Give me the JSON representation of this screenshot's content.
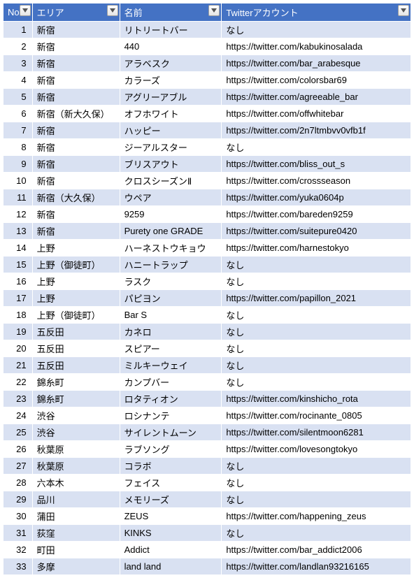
{
  "headers": {
    "no": "No.",
    "area": "エリア",
    "name": "名前",
    "twitter": "Twitterアカウント"
  },
  "rows": [
    {
      "no": "1",
      "area": "新宿",
      "name": "リトリートバー",
      "twitter": "なし"
    },
    {
      "no": "2",
      "area": "新宿",
      "name": "440",
      "twitter": "https://twitter.com/kabukinosalada"
    },
    {
      "no": "3",
      "area": "新宿",
      "name": "アラベスク",
      "twitter": "https://twitter.com/bar_arabesque"
    },
    {
      "no": "4",
      "area": "新宿",
      "name": "カラーズ",
      "twitter": "https://twitter.com/colorsbar69"
    },
    {
      "no": "5",
      "area": "新宿",
      "name": "アグリーアブル",
      "twitter": "https://twitter.com/agreeable_bar"
    },
    {
      "no": "6",
      "area": "新宿（新大久保）",
      "name": "オフホワイト",
      "twitter": "https://twitter.com/offwhitebar"
    },
    {
      "no": "7",
      "area": "新宿",
      "name": "ハッピー",
      "twitter": "https://twitter.com/2n7ltmbvv0vfb1f"
    },
    {
      "no": "8",
      "area": "新宿",
      "name": "ジーアルスター",
      "twitter": "なし"
    },
    {
      "no": "9",
      "area": "新宿",
      "name": "ブリスアウト",
      "twitter": "https://twitter.com/bliss_out_s"
    },
    {
      "no": "10",
      "area": "新宿",
      "name": "クロスシーズンⅡ",
      "twitter": "https://twitter.com/crossseason"
    },
    {
      "no": "11",
      "area": "新宿（大久保）",
      "name": "ウペア",
      "twitter": "https://twitter.com/yuka0604p"
    },
    {
      "no": "12",
      "area": "新宿",
      "name": "9259",
      "twitter": "https://twitter.com/bareden9259"
    },
    {
      "no": "13",
      "area": "新宿",
      "name": "Purety one GRADE",
      "twitter": "https://twitter.com/suitepure0420"
    },
    {
      "no": "14",
      "area": "上野",
      "name": "ハーネストウキョウ",
      "twitter": "https://twitter.com/harnestokyo"
    },
    {
      "no": "15",
      "area": "上野（御徒町）",
      "name": "ハニートラップ",
      "twitter": "なし"
    },
    {
      "no": "16",
      "area": "上野",
      "name": "ラスク",
      "twitter": "なし"
    },
    {
      "no": "17",
      "area": "上野",
      "name": "パピヨン",
      "twitter": "https://twitter.com/papillon_2021"
    },
    {
      "no": "18",
      "area": "上野（御徒町）",
      "name": "Bar S",
      "twitter": "なし"
    },
    {
      "no": "19",
      "area": "五反田",
      "name": "カネロ",
      "twitter": "なし"
    },
    {
      "no": "20",
      "area": "五反田",
      "name": "スピアー",
      "twitter": "なし"
    },
    {
      "no": "21",
      "area": "五反田",
      "name": "ミルキーウェイ",
      "twitter": "なし"
    },
    {
      "no": "22",
      "area": "錦糸町",
      "name": "カンプバー",
      "twitter": "なし"
    },
    {
      "no": "23",
      "area": "錦糸町",
      "name": "ロタティオン",
      "twitter": "https://twitter.com/kinshicho_rota"
    },
    {
      "no": "24",
      "area": "渋谷",
      "name": "ロシナンテ",
      "twitter": "https://twitter.com/rocinante_0805"
    },
    {
      "no": "25",
      "area": "渋谷",
      "name": "サイレントムーン",
      "twitter": "https://twitter.com/silentmoon6281"
    },
    {
      "no": "26",
      "area": "秋葉原",
      "name": "ラブソング",
      "twitter": "https://twitter.com/lovesongtokyo"
    },
    {
      "no": "27",
      "area": "秋葉原",
      "name": "コラボ",
      "twitter": "なし"
    },
    {
      "no": "28",
      "area": "六本木",
      "name": "フェイス",
      "twitter": "なし"
    },
    {
      "no": "29",
      "area": "品川",
      "name": "メモリーズ",
      "twitter": "なし"
    },
    {
      "no": "30",
      "area": "蒲田",
      "name": "ZEUS",
      "twitter": "https://twitter.com/happening_zeus"
    },
    {
      "no": "31",
      "area": "荻窪",
      "name": "KINKS",
      "twitter": "なし"
    },
    {
      "no": "32",
      "area": "町田",
      "name": "Addict",
      "twitter": "https://twitter.com/bar_addict2006"
    },
    {
      "no": "33",
      "area": "多摩",
      "name": "land land",
      "twitter": "https://twitter.com/landlan93216165"
    }
  ]
}
